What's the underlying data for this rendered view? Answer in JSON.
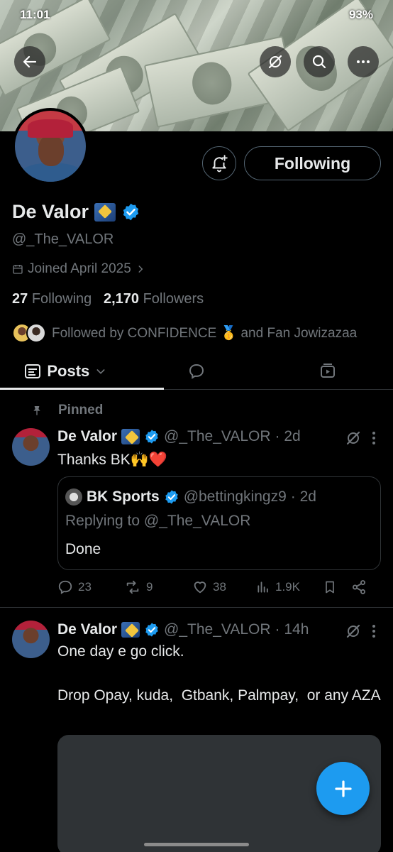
{
  "status_bar": {
    "time": "11:01",
    "battery": "93%"
  },
  "profile": {
    "display_name": "De Valor",
    "handle": "@_The_VALOR",
    "joined": "Joined April 2025",
    "following_count": "27",
    "following_label": "Following",
    "followers_count": "2,170",
    "followers_label": "Followers",
    "followed_by": "Followed by CONFIDENCE 🥇 and Fan Jowizazaa",
    "follow_button": "Following"
  },
  "tabs": [
    {
      "label": "Posts"
    }
  ],
  "pinned_label": "Pinned",
  "posts": [
    {
      "author": "De Valor",
      "handle": "@_The_VALOR",
      "time": "· 2d",
      "text": "Thanks BK🙌❤️",
      "quote": {
        "author": "BK Sports",
        "handle": "@bettingkingz9",
        "time": "· 2d",
        "replying": "Replying to @_The_VALOR",
        "text": "Done"
      },
      "replies": "23",
      "reposts": "9",
      "likes": "38",
      "views": "1.9K"
    },
    {
      "author": "De Valor",
      "handle": "@_The_VALOR",
      "time": "· 14h",
      "text": "One day e go click.\n\nDrop Opay, kuda,  Gtbank, Palmpay,  or any AZA"
    }
  ],
  "colors": {
    "accent": "#1d9bf0",
    "muted": "#71767b",
    "border": "#2f3336",
    "verified": "#1d9bf0"
  }
}
